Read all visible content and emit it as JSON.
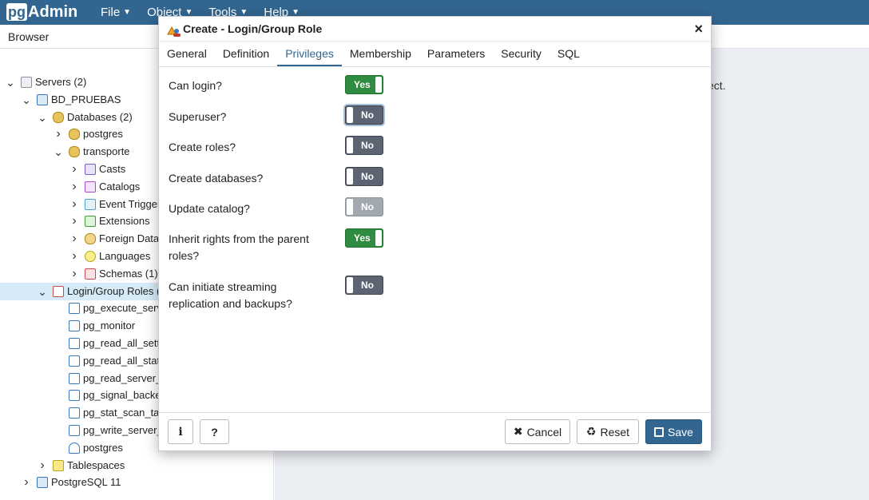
{
  "app": {
    "logo_pg": "pg",
    "logo_admin": "Admin",
    "menu": [
      {
        "label": "File"
      },
      {
        "label": "Object"
      },
      {
        "label": "Tools"
      },
      {
        "label": "Help"
      }
    ]
  },
  "browser": {
    "header": "Browser",
    "tree": [
      {
        "label": "Servers (2)",
        "depth": 0,
        "icon": "servers-icon",
        "tw": "v"
      },
      {
        "label": "BD_PRUEBAS",
        "depth": 1,
        "icon": "server-elephant-icon",
        "tw": "v"
      },
      {
        "label": "Databases (2)",
        "depth": 2,
        "icon": "databases-icon",
        "tw": "v"
      },
      {
        "label": "postgres",
        "depth": 3,
        "icon": "database-icon",
        "tw": ">"
      },
      {
        "label": "transporte",
        "depth": 3,
        "icon": "database-icon",
        "tw": "v"
      },
      {
        "label": "Casts",
        "depth": 4,
        "icon": "casts-icon",
        "tw": ">"
      },
      {
        "label": "Catalogs",
        "depth": 4,
        "icon": "catalogs-icon",
        "tw": ">"
      },
      {
        "label": "Event Triggers",
        "depth": 4,
        "icon": "event-triggers-icon",
        "tw": ">"
      },
      {
        "label": "Extensions",
        "depth": 4,
        "icon": "extensions-icon",
        "tw": ">"
      },
      {
        "label": "Foreign Data",
        "depth": 4,
        "icon": "foreign-data-icon",
        "tw": ">"
      },
      {
        "label": "Languages",
        "depth": 4,
        "icon": "languages-icon",
        "tw": ">"
      },
      {
        "label": "Schemas (1)",
        "depth": 4,
        "icon": "schemas-icon",
        "tw": ">"
      },
      {
        "label": "Login/Group Roles (",
        "depth": 2,
        "icon": "roles-icon",
        "tw": "v",
        "selected": true
      },
      {
        "label": "pg_execute_serve",
        "depth": 3,
        "icon": "group-role-icon",
        "tw": ""
      },
      {
        "label": "pg_monitor",
        "depth": 3,
        "icon": "group-role-icon",
        "tw": ""
      },
      {
        "label": "pg_read_all_setti",
        "depth": 3,
        "icon": "group-role-icon",
        "tw": ""
      },
      {
        "label": "pg_read_all_stats",
        "depth": 3,
        "icon": "group-role-icon",
        "tw": ""
      },
      {
        "label": "pg_read_server_f",
        "depth": 3,
        "icon": "group-role-icon",
        "tw": ""
      },
      {
        "label": "pg_signal_backer",
        "depth": 3,
        "icon": "group-role-icon",
        "tw": ""
      },
      {
        "label": "pg_stat_scan_tab",
        "depth": 3,
        "icon": "group-role-icon",
        "tw": ""
      },
      {
        "label": "pg_write_server_",
        "depth": 3,
        "icon": "group-role-icon",
        "tw": ""
      },
      {
        "label": "postgres",
        "depth": 3,
        "icon": "login-role-icon",
        "tw": ""
      },
      {
        "label": "Tablespaces",
        "depth": 2,
        "icon": "tablespaces-icon",
        "tw": ">"
      },
      {
        "label": "PostgreSQL 11",
        "depth": 1,
        "icon": "server-elephant-icon",
        "tw": ">"
      }
    ],
    "hint_fragment": "ect."
  },
  "dialog": {
    "title": "Create - Login/Group Role",
    "close": "×",
    "tabs": [
      {
        "label": "General"
      },
      {
        "label": "Definition"
      },
      {
        "label": "Privileges",
        "active": true
      },
      {
        "label": "Membership"
      },
      {
        "label": "Parameters"
      },
      {
        "label": "Security"
      },
      {
        "label": "SQL"
      }
    ],
    "fields": [
      {
        "label": "Can login?",
        "value": "Yes",
        "state": "on"
      },
      {
        "label": "Superuser?",
        "value": "No",
        "state": "off",
        "focus": true
      },
      {
        "label": "Create roles?",
        "value": "No",
        "state": "off"
      },
      {
        "label": "Create databases?",
        "value": "No",
        "state": "off"
      },
      {
        "label": "Update catalog?",
        "value": "No",
        "state": "dis"
      },
      {
        "label": "Inherit rights from the parent roles?",
        "value": "Yes",
        "state": "on"
      },
      {
        "label": "Can initiate streaming replication and backups?",
        "value": "No",
        "state": "off"
      }
    ],
    "footer": {
      "info": "i",
      "help": "?",
      "cancel": "Cancel",
      "reset": "Reset",
      "save": "Save"
    }
  },
  "colors": {
    "navbar": "#326690",
    "toggle_on": "#2e8b3f",
    "toggle_off": "#5b6470",
    "toggle_disabled": "#a2a8b0",
    "primary": "#326690"
  }
}
